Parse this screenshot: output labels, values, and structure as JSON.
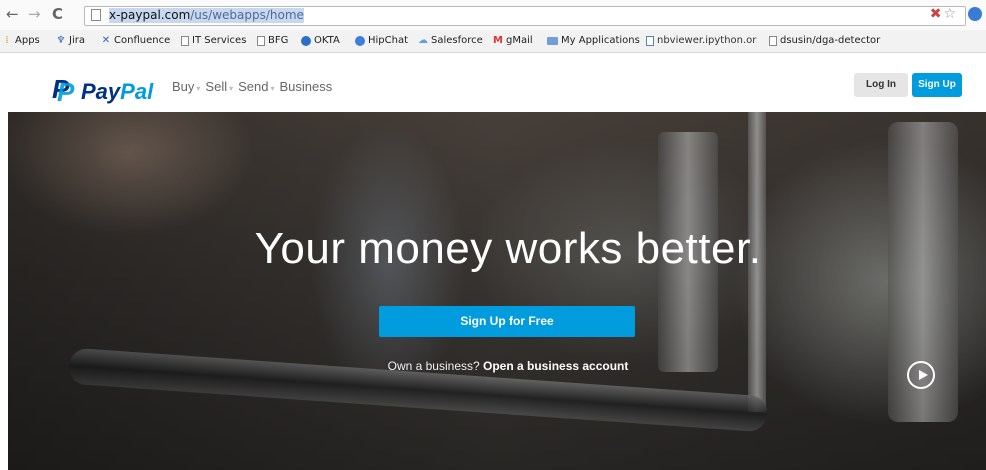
{
  "browser": {
    "url_domain": "x-paypal.com",
    "url_path": "/us/webapps/home",
    "icons": [
      "back-icon",
      "forward-icon",
      "reload-icon",
      "page-icon",
      "extension-icon",
      "star-icon"
    ]
  },
  "bookmarks": [
    {
      "label": "Apps",
      "icon": "apps-icon"
    },
    {
      "label": "Jira",
      "icon": "jira-icon"
    },
    {
      "label": "Confluence",
      "icon": "confluence-icon"
    },
    {
      "label": "IT Services",
      "icon": "doc-icon"
    },
    {
      "label": "BFG",
      "icon": "doc-icon"
    },
    {
      "label": "OKTA",
      "icon": "okta-icon"
    },
    {
      "label": "HipChat",
      "icon": "hipchat-icon"
    },
    {
      "label": "Salesforce",
      "icon": "salesforce-icon"
    },
    {
      "label": "gMail",
      "icon": "gmail-icon"
    },
    {
      "label": "My Applications",
      "icon": "folder-icon"
    },
    {
      "label": "nbviewer.ipython.or",
      "icon": "nbviewer-icon"
    },
    {
      "label": "dsusin/dga-detector",
      "icon": "doc-icon"
    }
  ],
  "header": {
    "logo_pay": "Pay",
    "logo_pal": "Pal",
    "nav": [
      "Buy",
      "Sell",
      "Send",
      "Business"
    ],
    "login_label": "Log In",
    "signup_label": "Sign Up"
  },
  "hero": {
    "headline": "Your money works better.",
    "cta_label": "Sign Up for Free",
    "business_prompt": "Own a business?",
    "business_link": "Open a business account"
  },
  "colors": {
    "brand_dark": "#003087",
    "brand_light": "#009cde"
  }
}
